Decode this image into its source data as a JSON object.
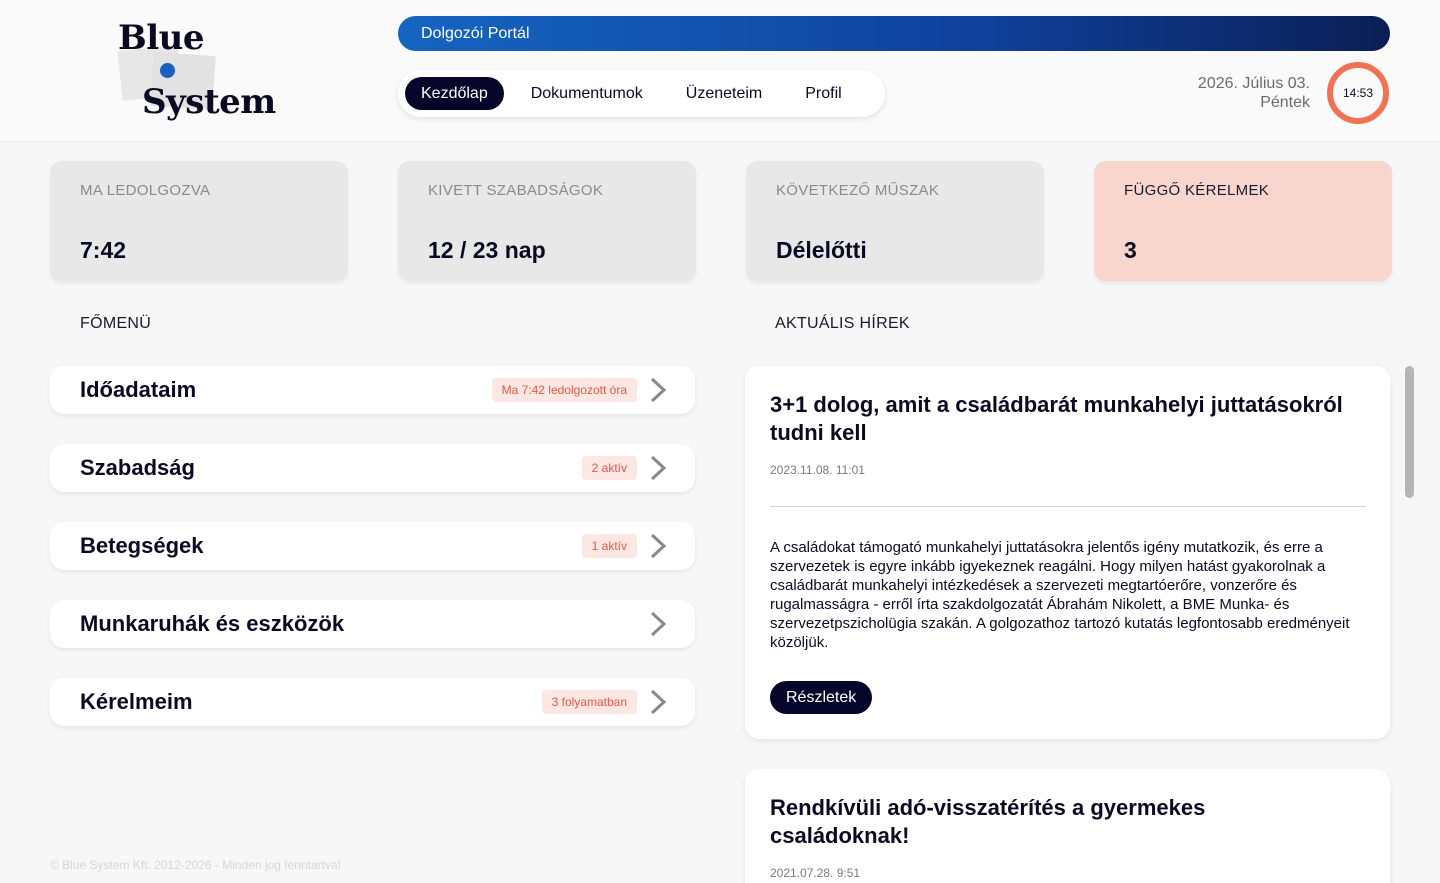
{
  "logo": {
    "line1": "Blue",
    "line2": "System"
  },
  "portal": {
    "title": "Dolgozói Portál"
  },
  "nav": {
    "tabs": [
      {
        "label": "Kezdőlap",
        "active": true
      },
      {
        "label": "Dokumentumok",
        "active": false
      },
      {
        "label": "Üzeneteim",
        "active": false
      },
      {
        "label": "Profil",
        "active": false
      }
    ]
  },
  "date": {
    "date": "2026. Július 03.",
    "weekday": "Péntek"
  },
  "clock": {
    "time": "14:53",
    "accent": "#f07355"
  },
  "stats": [
    {
      "label": "MA LEDOLGOZVA",
      "value": "7:42"
    },
    {
      "label": "KIVETT SZABADSÁGOK",
      "value": "12 / 23 nap"
    },
    {
      "label": "KÖVETKEZŐ MŰSZAK",
      "value": "Délelőtti"
    },
    {
      "label": "FÜGGŐ KÉRELMEK",
      "value": "3"
    }
  ],
  "main_menu": {
    "title": "FŐMENÜ",
    "items": [
      {
        "label": "Időadataim",
        "badge": "Ma 7:42 ledolgozott óra"
      },
      {
        "label": "Szabadság",
        "badge": "2 aktív"
      },
      {
        "label": "Betegségek",
        "badge": "1 aktív"
      },
      {
        "label": "Munkaruhák és eszközök",
        "badge": ""
      },
      {
        "label": "Kérelmeim",
        "badge": "3 folyamatban"
      }
    ]
  },
  "news": {
    "title": "AKTUÁLIS HÍREK",
    "items": [
      {
        "title": "3+1 dolog, amit a családbarát munkahelyi juttatásokról tudni kell",
        "time": "2023.11.08. 11:01",
        "body": "A családokat támogató munkahelyi juttatásokra jelentős igény mutatkozik, és erre a szervezetek is egyre inkább igyekeznek reagálni. Hogy milyen hatást gyakorolnak a családbarát munkahelyi intézkedések a szervezeti megtartóerőre, vonzerőre és rugalmasságra - erről írta szakdolgozatát Ábrahám Nikolett, a BME Munka- és szervezetpszicholügia szakán. A golgozathoz tartozó kutatás legfontosabb eredményeit közöljük.",
        "button": "Részletek"
      },
      {
        "title": "Rendkívüli adó-visszatérítés a gyermekes családoknak!",
        "time": "2021.07.28. 9:51"
      }
    ]
  },
  "footer": {
    "text": "© Blue System Kft. 2012-2026 - Minden jog fenntartva!"
  },
  "colors": {
    "brand_dark": "#06062a",
    "brand_blue": "#1565c0",
    "alert_bg": "#f8d5cd",
    "badge_text": "#e15a45"
  }
}
